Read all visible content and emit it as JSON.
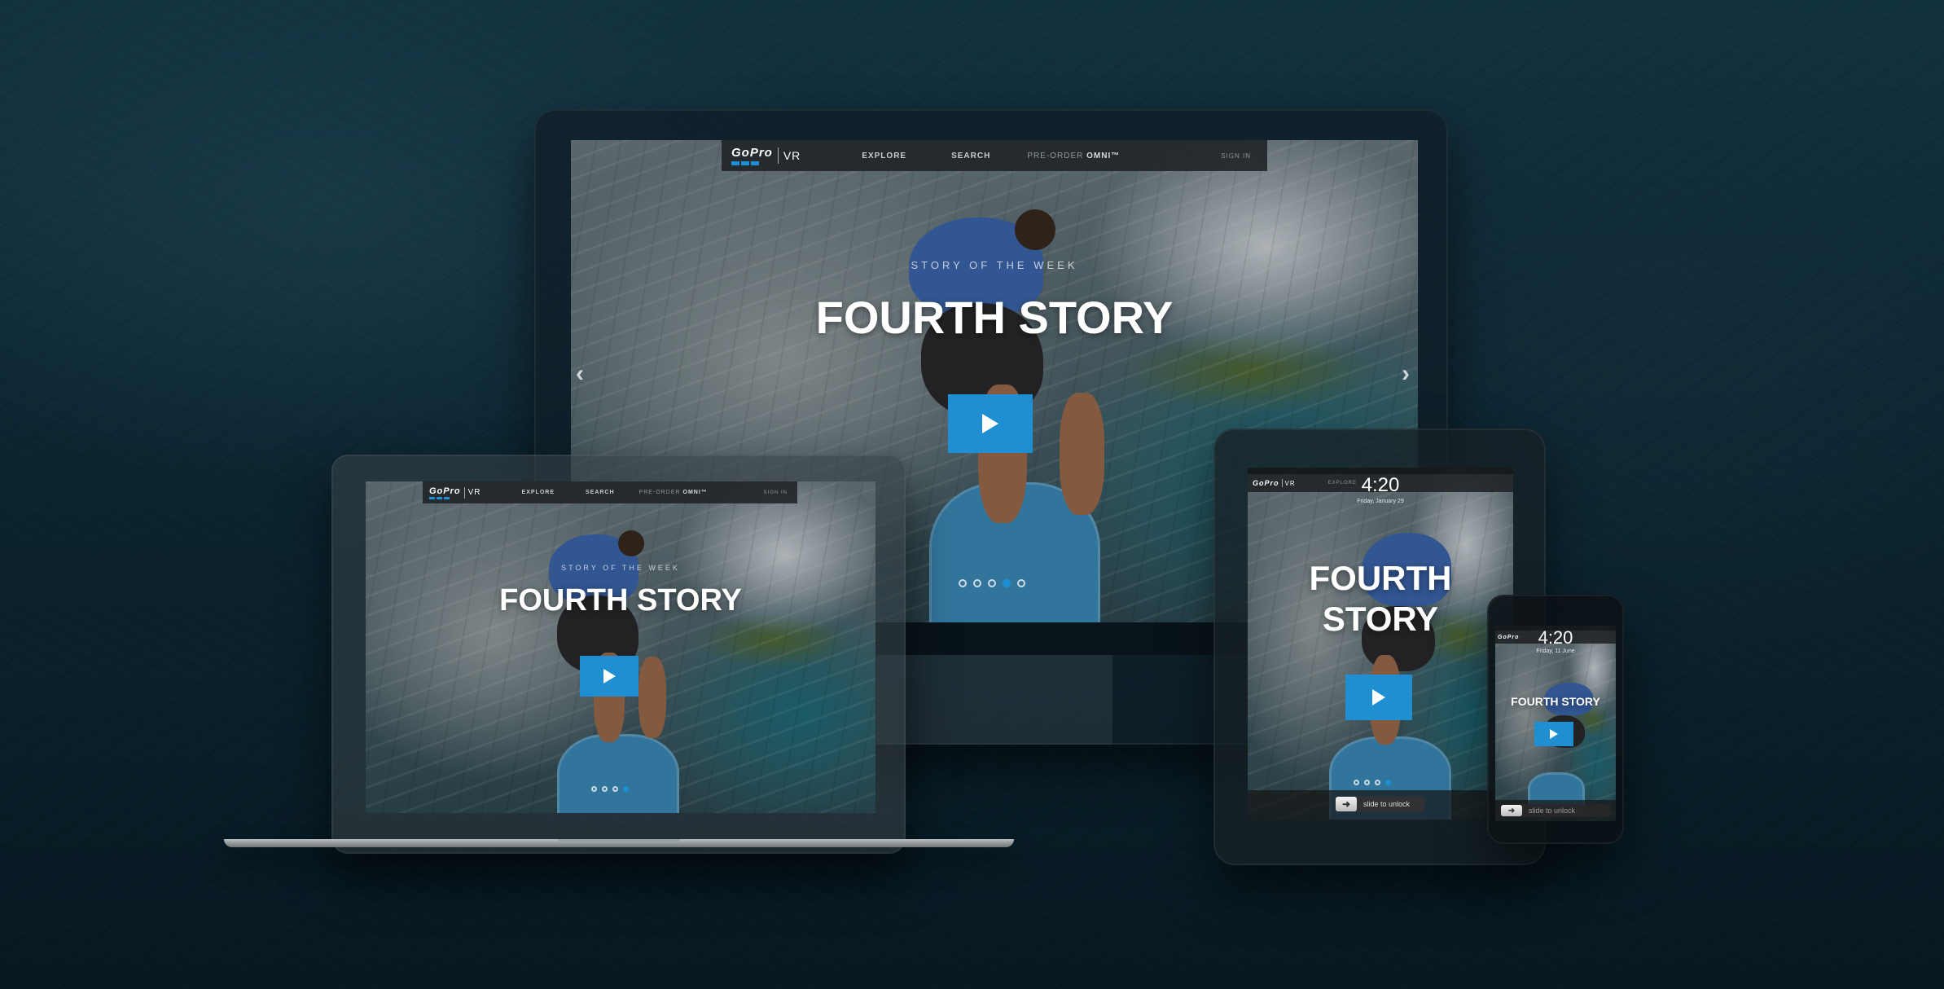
{
  "brand": {
    "logo_text": "GoPro",
    "product": "VR",
    "accent_color": "#1f8fd1"
  },
  "nav": {
    "explore": "EXPLORE",
    "search": "SEARCH",
    "preorder_prefix": "PRE-ORDER",
    "preorder_product": "OMNI™",
    "signin": "SIGN IN"
  },
  "hero": {
    "kicker": "STORY OF THE WEEK",
    "title": "FOURTH STORY",
    "title_line1": "FOURTH",
    "title_line2": "STORY",
    "play_icon": "play-icon",
    "prev_arrow": "‹",
    "next_arrow": "›"
  },
  "carousel": {
    "slide_count": 4,
    "active_index": 3
  },
  "tablet_lock": {
    "time": "4:20",
    "date": "Friday, January 29",
    "slide_label": "slide to unlock"
  },
  "phone_lock": {
    "time": "4:20",
    "date": "Friday, 11 June",
    "slide_label": "slide to unlock"
  }
}
